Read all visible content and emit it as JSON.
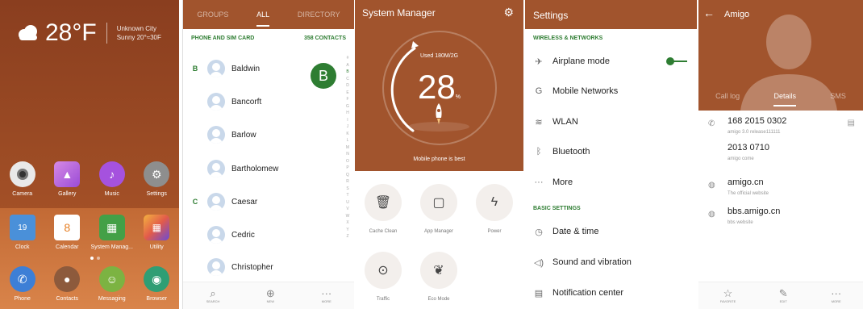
{
  "home": {
    "weather": {
      "temp": "28°F",
      "city": "Unknown City",
      "condition": "Sunny 20°≈30F"
    },
    "apps_row1": [
      {
        "label": "Camera",
        "icon": "camera-icon",
        "color": "#e9e9e9"
      },
      {
        "label": "Gallery",
        "icon": "gallery-icon",
        "color": "#b86fe0"
      },
      {
        "label": "Music",
        "icon": "music-icon",
        "color": "#a552de"
      },
      {
        "label": "Settings",
        "icon": "settings-icon",
        "color": "#8e8e8e"
      }
    ],
    "apps_row2": [
      {
        "label": "Clock",
        "icon": "clock-icon",
        "color": "#4a90d9",
        "text": "19"
      },
      {
        "label": "Calendar",
        "icon": "calendar-icon",
        "color": "#ffffff",
        "text": "8"
      },
      {
        "label": "System Manag...",
        "icon": "system-manager-icon",
        "color": "#43a047"
      },
      {
        "label": "Utility",
        "icon": "utility-icon",
        "color": "#e6a23a"
      }
    ],
    "dock": [
      {
        "label": "Phone",
        "icon": "phone-icon",
        "color": "#3d7fd6"
      },
      {
        "label": "Contacts",
        "icon": "contacts-icon",
        "color": "#8d5a3c"
      },
      {
        "label": "Messaging",
        "icon": "messaging-icon",
        "color": "#7cb342"
      },
      {
        "label": "Browser",
        "icon": "browser-icon",
        "color": "#2f9e74"
      }
    ]
  },
  "contacts": {
    "tabs": [
      "GROUPS",
      "ALL",
      "DIRECTORY"
    ],
    "header_left": "PHONE AND SIM CARD",
    "header_right": "358 CONTACTS",
    "bubble": "B",
    "list": [
      {
        "letter": "B",
        "name": "Baldwin"
      },
      {
        "letter": "",
        "name": "Bancorft"
      },
      {
        "letter": "",
        "name": "Barlow"
      },
      {
        "letter": "",
        "name": "Bartholomew"
      },
      {
        "letter": "C",
        "name": "Caesar"
      },
      {
        "letter": "",
        "name": "Cedric"
      },
      {
        "letter": "",
        "name": "Christopher"
      }
    ],
    "alphabet": [
      "#",
      "A",
      "B",
      "C",
      "D",
      "E",
      "F",
      "G",
      "H",
      "I",
      "J",
      "K",
      "L",
      "M",
      "N",
      "O",
      "P",
      "Q",
      "R",
      "S",
      "T",
      "U",
      "V",
      "W",
      "X",
      "Y",
      "Z"
    ],
    "bottom": [
      {
        "label": "SEARCH",
        "glyph": "⌕"
      },
      {
        "label": "NEW",
        "glyph": "⊕"
      },
      {
        "label": "MORE",
        "glyph": "···"
      }
    ]
  },
  "system_manager": {
    "title": "System Manager",
    "used": "Used 180M/2G",
    "percent": "28",
    "percent_sign": "%",
    "status": "Mobile phone is best",
    "tools": [
      {
        "label": "Cache Clean",
        "glyph": "🗑"
      },
      {
        "label": "App Manager",
        "glyph": "▢"
      },
      {
        "label": "Power",
        "glyph": "ϟ"
      },
      {
        "label": "Traffic",
        "glyph": "⊙"
      },
      {
        "label": "Eco Mode",
        "glyph": "❦"
      }
    ]
  },
  "settings": {
    "title": "Settings",
    "section1": "WIRELESS & NETWORKS",
    "section2": "BASIC SETTINGS",
    "rows1": [
      {
        "label": "Airplane mode",
        "glyph": "✈"
      },
      {
        "label": "Mobile Networks",
        "glyph": "G"
      },
      {
        "label": "WLAN",
        "glyph": "≋"
      },
      {
        "label": "Bluetooth",
        "glyph": "ᛒ"
      },
      {
        "label": "More",
        "glyph": "···"
      }
    ],
    "rows2": [
      {
        "label": "Date & time",
        "glyph": "◷"
      },
      {
        "label": "Sound and vibration",
        "glyph": "◁)"
      },
      {
        "label": "Notification center",
        "glyph": "▤"
      }
    ]
  },
  "contact_detail": {
    "name": "Amigo",
    "tabs": [
      "Call log",
      "Details",
      "SMS"
    ],
    "entries": [
      {
        "value": "168 2015 0302",
        "sub": "amigo 3.0 release111111",
        "glyph": "✆"
      },
      {
        "value": "2013 0710",
        "sub": "amigo come",
        "glyph": ""
      },
      {
        "value": "amigo.cn",
        "sub": "The official website",
        "glyph": "◍"
      },
      {
        "value": "bbs.amigo.cn",
        "sub": "bbs website",
        "glyph": "◍"
      }
    ],
    "bottom": [
      {
        "label": "FAVORITE",
        "glyph": "☆"
      },
      {
        "label": "EDIT",
        "glyph": "✎"
      },
      {
        "label": "MORE",
        "glyph": "···"
      }
    ]
  }
}
